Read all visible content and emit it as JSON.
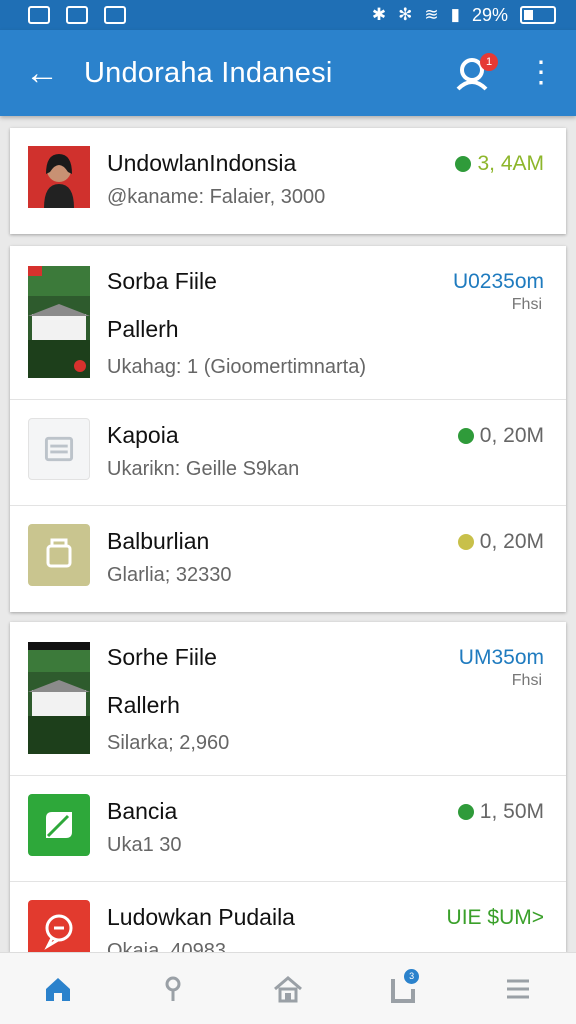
{
  "status_bar": {
    "time_left_icons": [
      "mail-icon",
      "image-icon",
      "mail-check-icon"
    ],
    "right_icons": [
      "bluetooth-icon",
      "asterisk-icon",
      "wifi-icon",
      "signal-icon"
    ],
    "battery": "29%"
  },
  "header": {
    "title": "Undoraha Indanesi",
    "notification_count": "1"
  },
  "cards": [
    {
      "rows": [
        {
          "name": "UndowlanIndonsia",
          "sub": "@kaname: Falaier, 3000",
          "price": "3, 4AM",
          "price_color": "#8db62b",
          "dot_color": "#2f9b3a",
          "thumb": "avatar"
        }
      ]
    },
    {
      "rows": [
        {
          "name": "Sorba Fiile",
          "name2": "Pallerh",
          "sub": "Ukahag: 1 (Gioomertimnarta)",
          "price": "U0235om",
          "extra": "Fhsi",
          "price_color": "#1f7bbf",
          "thumb": "villa"
        },
        {
          "name": "Kapoia",
          "sub": "Ukarikn: Geille S9kan",
          "price": "0, 20M",
          "price_color": "#666",
          "dot_color": "#2f9b3a",
          "thumb": "calendar"
        },
        {
          "name": "Balburlian",
          "sub": "Glarlia; 32330",
          "price": "0, 20M",
          "price_color": "#666",
          "dot_color": "#c8c04a",
          "thumb": "cart"
        }
      ]
    },
    {
      "rows": [
        {
          "name": "Sorhe Fiile",
          "name2": "Rallerh",
          "sub": "Silarka; 2,960",
          "price": "UM35om",
          "extra": "Fhsi",
          "price_color": "#1f7bbf",
          "thumb": "villa"
        },
        {
          "name": "Bancia",
          "sub": "Uka1 30",
          "price": "1, 50M",
          "price_color": "#666",
          "dot_color": "#2f9b3a",
          "thumb": "leaf"
        },
        {
          "name": "Ludowkan Pudaila",
          "sub": "Okaia, 40983",
          "price": "UIE $UM>",
          "price_color": "#3aa02a",
          "thumb": "chat"
        }
      ]
    }
  ],
  "bottom_nav": [
    "home-icon",
    "location-pin-icon",
    "house-icon",
    "notes-icon",
    "menu-icon"
  ],
  "bottom_nav_badge": "3"
}
